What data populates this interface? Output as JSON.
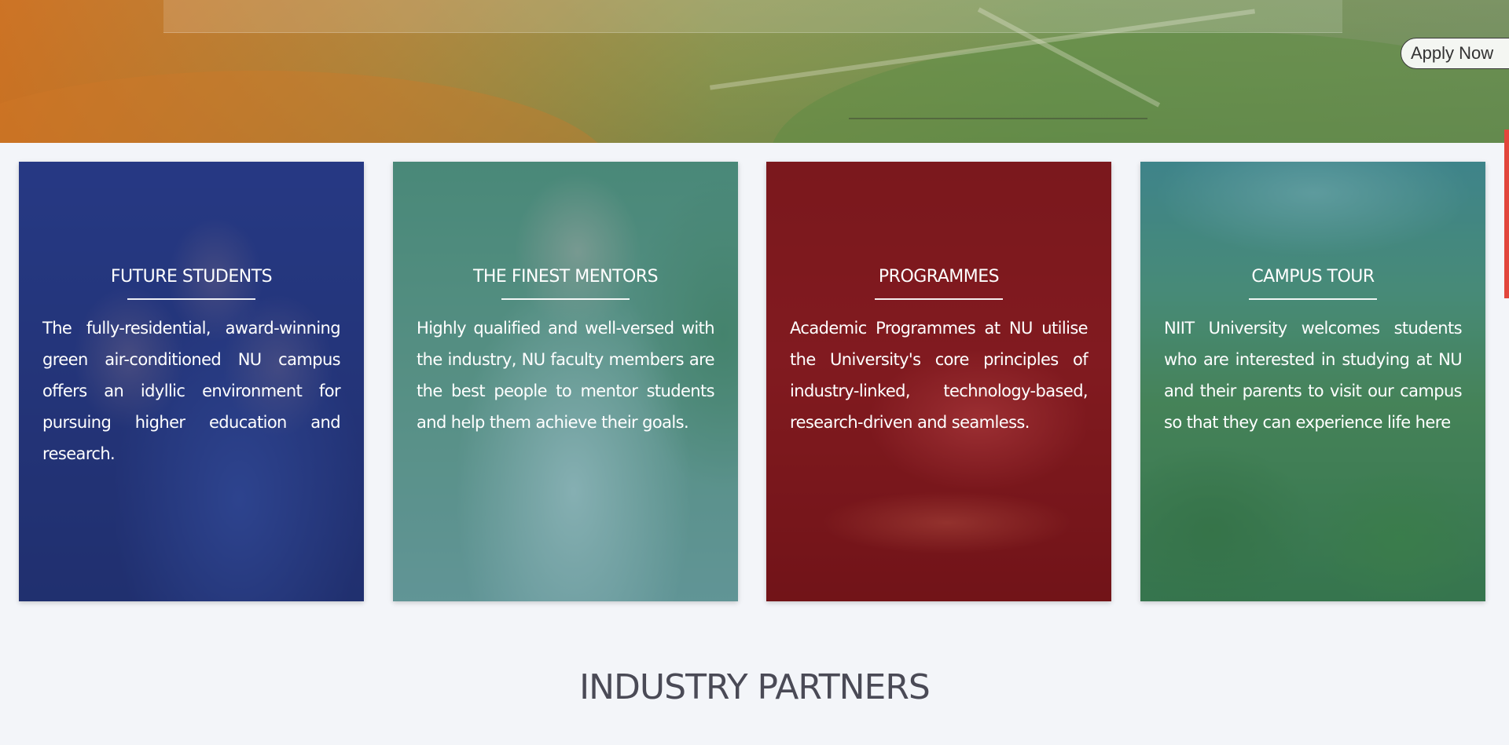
{
  "header": {
    "apply_label": "Apply Now"
  },
  "cards": [
    {
      "title": "FUTURE STUDENTS",
      "body": "The fully-residential, award-winning green air-conditioned NU campus offers an idyllic environment for pursuing higher education and research."
    },
    {
      "title": "THE FINEST MENTORS",
      "body": "Highly qualified and well-versed with the industry, NU faculty members are the best people to mentor students and help them achieve their goals."
    },
    {
      "title": "PROGRAMMES",
      "body": "Academic Programmes at NU utilise the University's core principles of industry-linked, technology-based, research-driven and seamless."
    },
    {
      "title": "CAMPUS TOUR",
      "body": "NIIT University welcomes students who are interested in studying at NU and their parents to visit our campus so that they can experience life here"
    }
  ],
  "partners": {
    "title": "INDUSTRY PARTNERS"
  },
  "colors": {
    "accent": "#e2463c",
    "students_tint": "#23378a",
    "mentors_tint": "#46878c",
    "programmes_tint": "#78141a",
    "campus_tint": "#2d7869"
  }
}
